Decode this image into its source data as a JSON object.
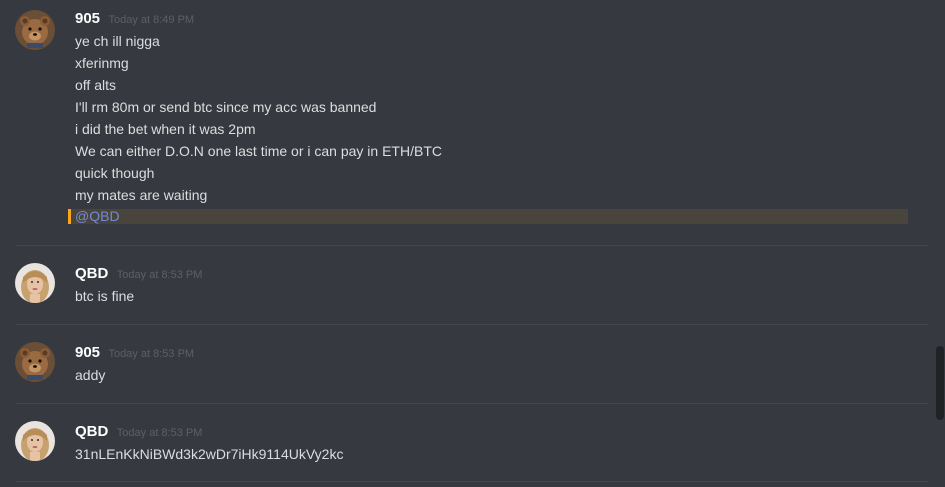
{
  "messages": [
    {
      "username": "905",
      "timestamp": "Today at 8:49 PM",
      "avatar_icon": "teddy-bear-avatar-icon",
      "lines": [
        "ye ch ill nigga",
        "xferinmg",
        "off alts",
        "I'll rm 80m or send btc since my acc was banned",
        "i did the bet when it was 2pm",
        "We can either D.O.N one last time or i can pay in ETH/BTC",
        "quick though",
        "my mates are waiting"
      ],
      "mention": "@QBD"
    },
    {
      "username": "QBD",
      "timestamp": "Today at 8:53 PM",
      "avatar_icon": "woman-portrait-avatar-icon",
      "lines": [
        "btc is fine"
      ]
    },
    {
      "username": "905",
      "timestamp": "Today at 8:53 PM",
      "avatar_icon": "teddy-bear-avatar-icon",
      "lines": [
        "addy"
      ]
    },
    {
      "username": "QBD",
      "timestamp": "Today at 8:53 PM",
      "avatar_icon": "woman-portrait-avatar-icon",
      "lines": [
        "31nLEnKkNiBWd3k2wDr7iHk9114UkVy2kc"
      ]
    }
  ],
  "colors": {
    "background": "#36393f",
    "username": "#ffffff",
    "timestamp": "#5c6066",
    "message_text": "#dcddde",
    "mention_highlight": "#49443c",
    "mention_bar": "#faa61a",
    "mention_text": "#7289da"
  }
}
